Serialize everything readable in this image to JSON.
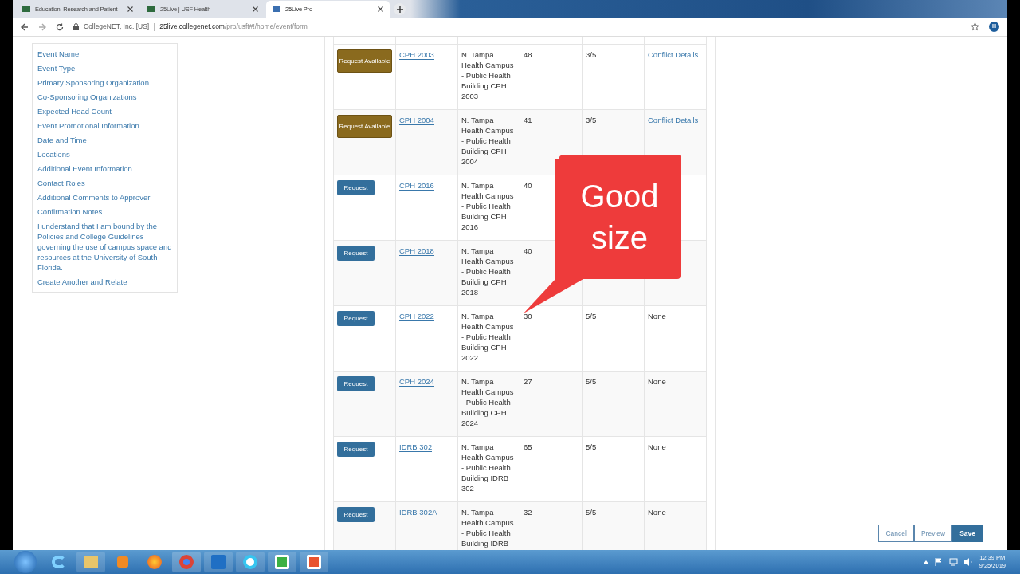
{
  "browser": {
    "tabs": [
      {
        "title": "Education, Research and Patient",
        "selected": false
      },
      {
        "title": "25Live | USF Health",
        "selected": false
      },
      {
        "title": "25Live Pro",
        "selected": true
      }
    ],
    "address": {
      "site": "CollegeNET, Inc. [US]",
      "host": "25live.collegenet.com",
      "path": "/pro/usft#!/home/event/form"
    },
    "avatar": "H"
  },
  "sidebar": {
    "items": [
      "Event Name",
      "Event Type",
      "Primary Sponsoring Organization",
      "Co-Sponsoring Organizations",
      "Expected Head Count",
      "Event Promotional Information",
      "Date and Time",
      "Locations",
      "Additional Event Information",
      "Contact Roles",
      "Additional Comments to Approver",
      "Confirmation Notes",
      "I understand that I am bound by the Policies and College Guidelines governing the use of campus space and resources at the University of South Florida.",
      "Create Another and Relate"
    ]
  },
  "table": {
    "rows": [
      {
        "action": {
          "kind": "available",
          "label": "Request Available"
        },
        "room": "CPH 2003",
        "location": "N. Tampa Health Campus - Public Health Building CPH 2003",
        "capacity": "48",
        "availability": "3/5",
        "conflicts": "Conflict Details"
      },
      {
        "action": {
          "kind": "available",
          "label": "Request Available"
        },
        "room": "CPH 2004",
        "location": "N. Tampa Health Campus - Public Health Building CPH 2004",
        "capacity": "41",
        "availability": "3/5",
        "conflicts": "Conflict Details"
      },
      {
        "action": {
          "kind": "request",
          "label": "Request"
        },
        "room": "CPH 2016",
        "location": "N. Tampa Health Campus - Public Health Building CPH 2016",
        "capacity": "40"
      },
      {
        "action": {
          "kind": "request",
          "label": "Request"
        },
        "room": "CPH 2018",
        "location": "N. Tampa Health Campus - Public Health Building CPH 2018",
        "capacity": "40"
      },
      {
        "action": {
          "kind": "request",
          "label": "Request"
        },
        "room": "CPH 2022",
        "location": "N. Tampa Health Campus - Public Health Building CPH 2022",
        "capacity": "30",
        "availability": "5/5",
        "conflicts": "None"
      },
      {
        "action": {
          "kind": "request",
          "label": "Request"
        },
        "room": "CPH 2024",
        "location": "N. Tampa Health Campus - Public Health Building CPH 2024",
        "capacity": "27",
        "availability": "5/5",
        "conflicts": "None"
      },
      {
        "action": {
          "kind": "request",
          "label": "Request"
        },
        "room": "IDRB 302",
        "location": "N. Tampa Health Campus - Public Health Building IDRB 302",
        "capacity": "65",
        "availability": "5/5",
        "conflicts": "None"
      },
      {
        "action": {
          "kind": "request",
          "label": "Request"
        },
        "room": "IDRB 302A",
        "location": "N. Tampa Health Campus - Public Health Building IDRB",
        "capacity": "32",
        "availability": "5/5",
        "conflicts": "None"
      }
    ]
  },
  "callout": {
    "text": "Good size"
  },
  "actions": [
    "Cancel",
    "Preview",
    "Save"
  ],
  "taskbar": {
    "time": "12:39 PM",
    "date": "9/25/2019"
  }
}
